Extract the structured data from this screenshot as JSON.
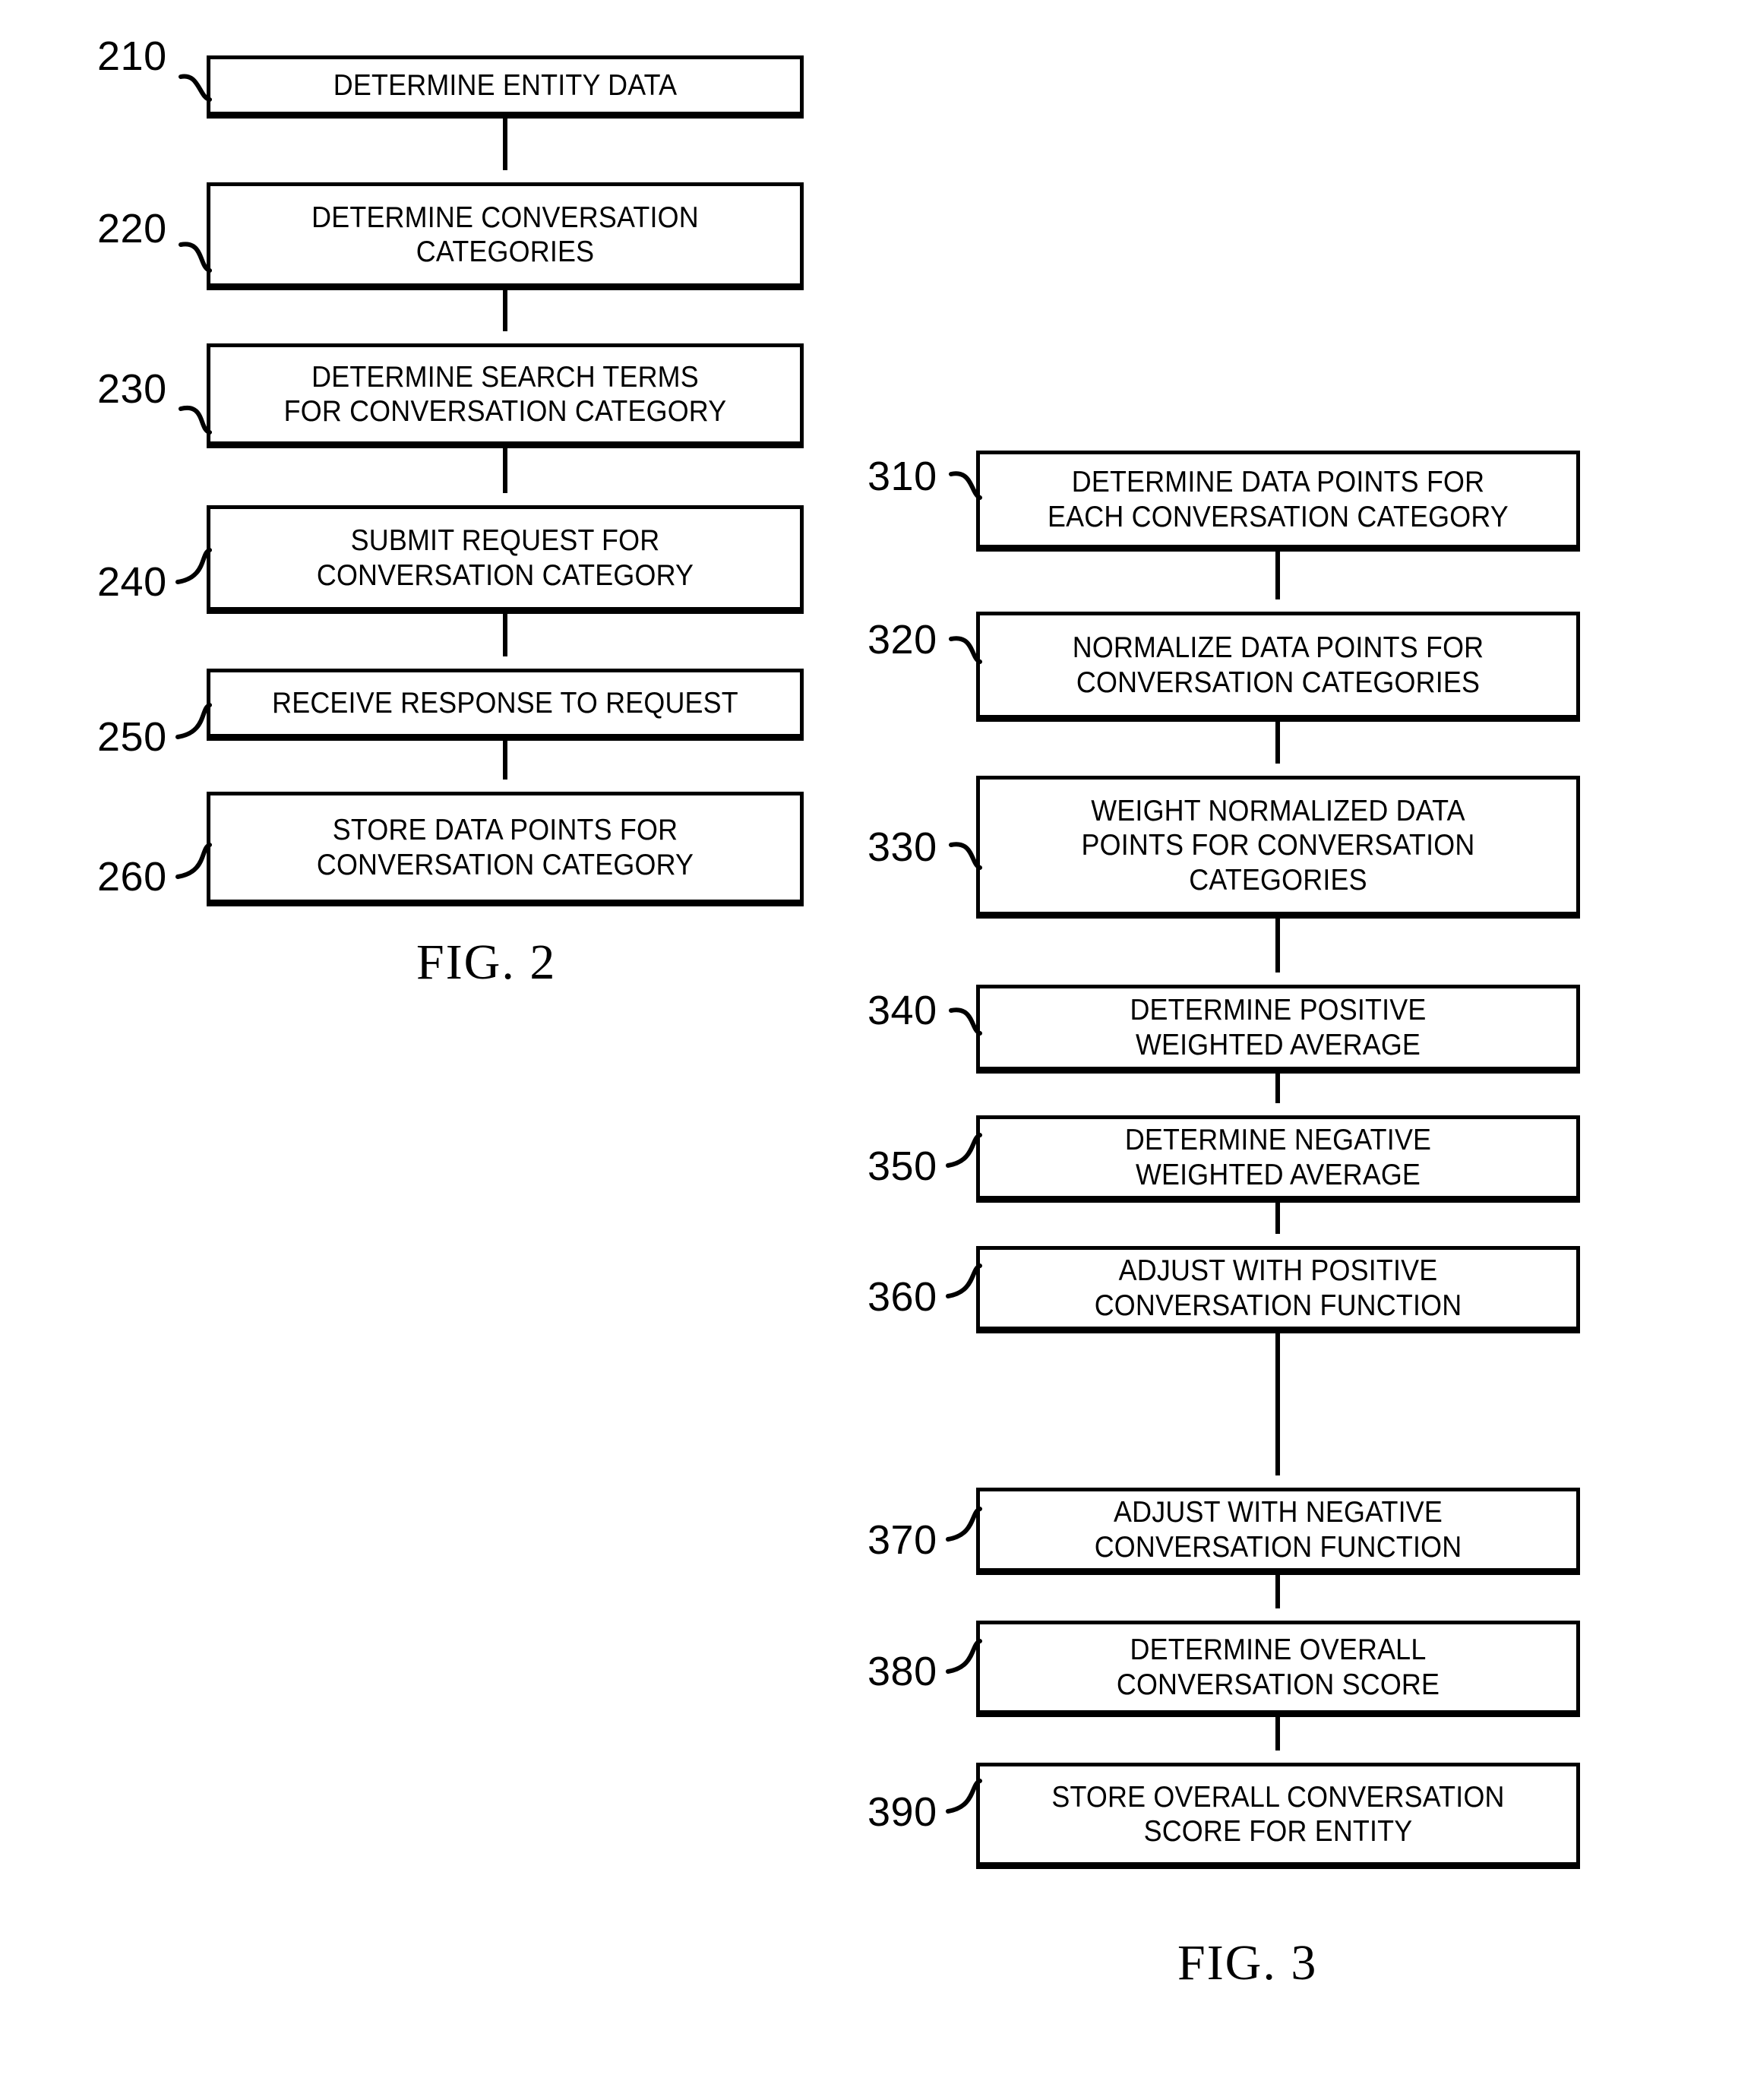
{
  "document": {
    "type": "patent-flowchart-sheet",
    "background_color": "#ffffff",
    "ink_color": "#000000"
  },
  "figures": [
    {
      "id": "fig-2",
      "caption": "FIG. 2",
      "nodes": [
        {
          "ref": "210",
          "text": "DETERMINE ENTITY DATA"
        },
        {
          "ref": "220",
          "text": "DETERMINE CONVERSATION\nCATEGORIES"
        },
        {
          "ref": "230",
          "text": "DETERMINE SEARCH TERMS\nFOR CONVERSATION CATEGORY"
        },
        {
          "ref": "240",
          "text": "SUBMIT REQUEST FOR\nCONVERSATION CATEGORY"
        },
        {
          "ref": "250",
          "text": "RECEIVE RESPONSE TO REQUEST"
        },
        {
          "ref": "260",
          "text": "STORE DATA POINTS FOR\nCONVERSATION CATEGORY"
        }
      ]
    },
    {
      "id": "fig-3",
      "caption": "FIG. 3",
      "nodes": [
        {
          "ref": "310",
          "text": "DETERMINE DATA POINTS FOR\nEACH CONVERSATION CATEGORY"
        },
        {
          "ref": "320",
          "text": "NORMALIZE DATA POINTS FOR\nCONVERSATION CATEGORIES"
        },
        {
          "ref": "330",
          "text": "WEIGHT NORMALIZED DATA\nPOINTS FOR CONVERSATION\nCATEGORIES"
        },
        {
          "ref": "340",
          "text": "DETERMINE POSITIVE\nWEIGHTED AVERAGE"
        },
        {
          "ref": "350",
          "text": "DETERMINE NEGATIVE\nWEIGHTED AVERAGE"
        },
        {
          "ref": "360",
          "text": "ADJUST WITH POSITIVE\nCONVERSATION FUNCTION"
        },
        {
          "ref": "370",
          "text": "ADJUST WITH NEGATIVE\nCONVERSATION FUNCTION"
        },
        {
          "ref": "380",
          "text": "DETERMINE OVERALL\nCONVERSATION SCORE"
        },
        {
          "ref": "390",
          "text": "STORE OVERALL CONVERSATION\nSCORE FOR ENTITY"
        }
      ]
    }
  ]
}
